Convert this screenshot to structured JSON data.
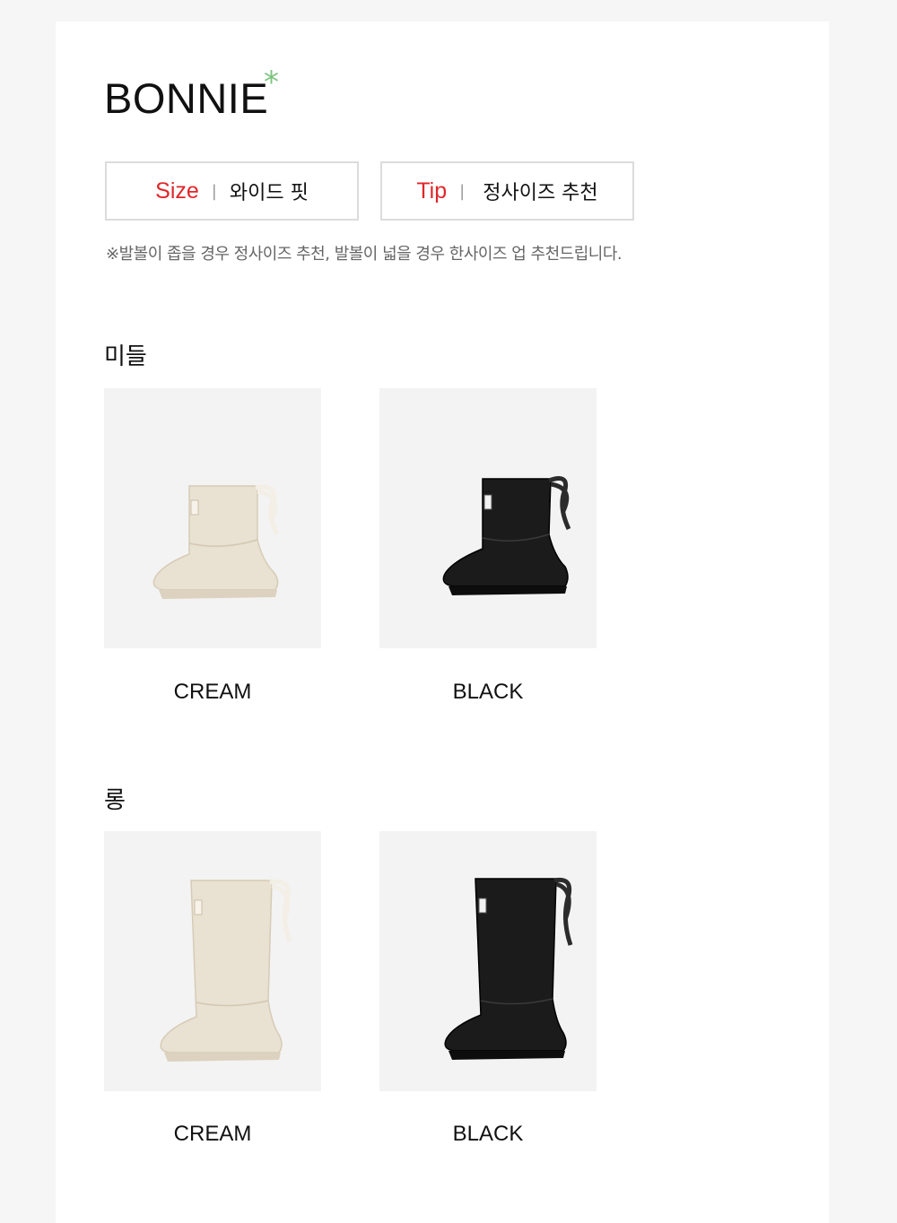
{
  "title": "BONNIE",
  "title_mark": "*",
  "accent_color": "#7ec47f",
  "label_color": "#e0262a",
  "size_box": {
    "key": "Size",
    "separator": "|",
    "value": "와이드 핏"
  },
  "tip_box": {
    "key": "Tip",
    "separator": "|",
    "value": "정사이즈 추천"
  },
  "note": "※발볼이 좁을 경우 정사이즈 추천, 발볼이 넓을 경우 한사이즈 업 추천드립니다.",
  "sections": [
    {
      "label": "미들",
      "items": [
        {
          "name": "CREAM",
          "icon": "cream-mid-boot-icon"
        },
        {
          "name": "BLACK",
          "icon": "black-mid-boot-icon"
        }
      ]
    },
    {
      "label": "롱",
      "items": [
        {
          "name": "CREAM",
          "icon": "cream-long-boot-icon"
        },
        {
          "name": "BLACK",
          "icon": "black-long-boot-icon"
        }
      ]
    }
  ]
}
